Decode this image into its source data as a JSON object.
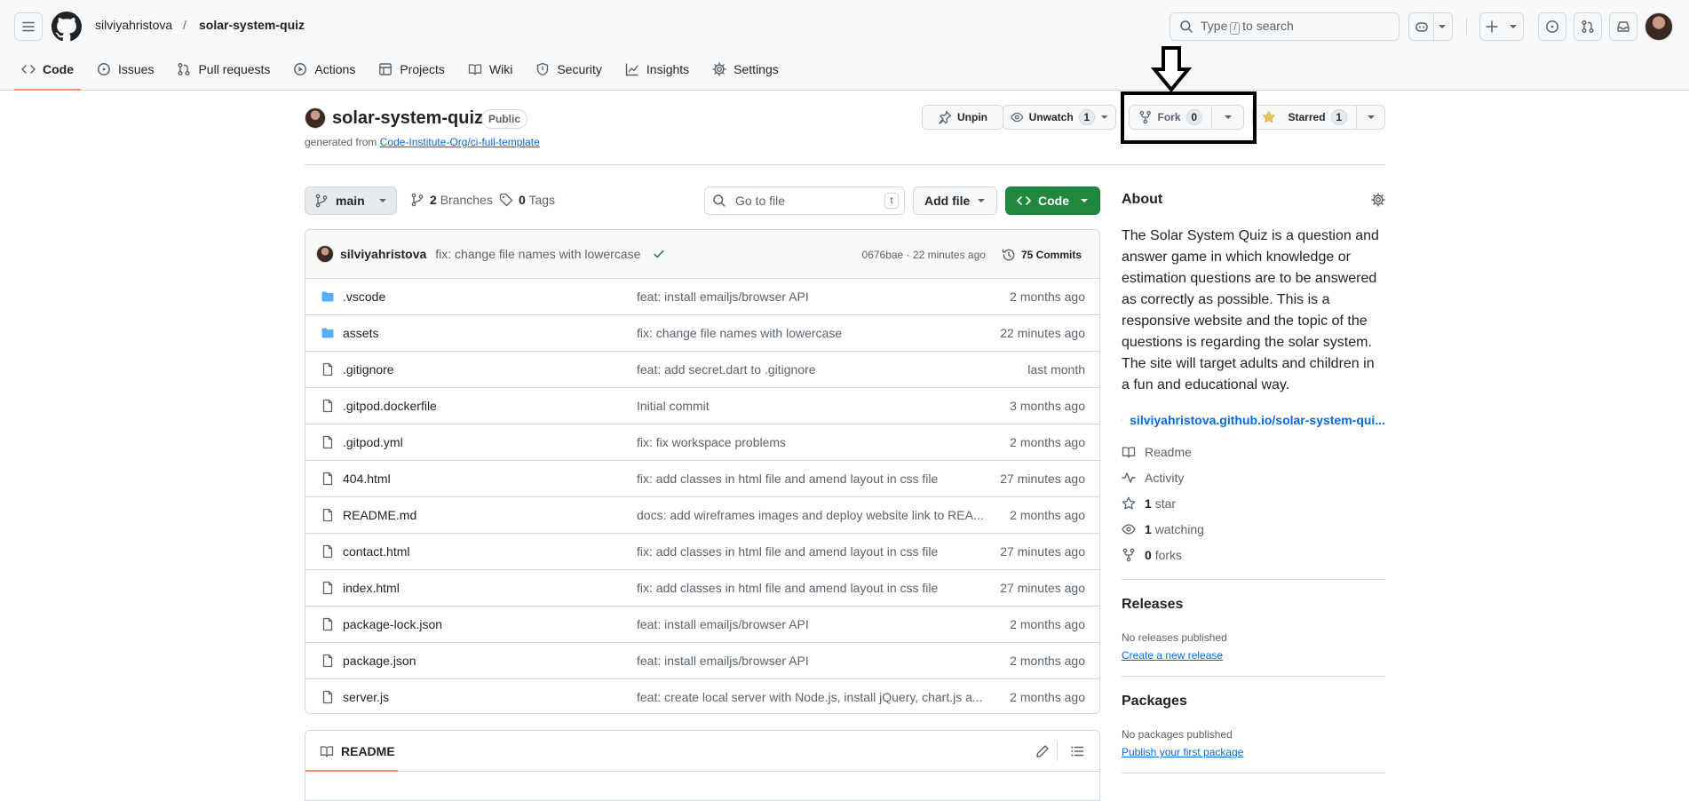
{
  "header": {
    "owner": "silviyahristova",
    "separator": "/",
    "repo": "solar-system-quiz",
    "search": {
      "prefix": "Type",
      "key": "/",
      "suffix": "to search"
    }
  },
  "tabs": [
    {
      "label": "Code",
      "icon": "code-icon",
      "selected": true
    },
    {
      "label": "Issues",
      "icon": "issue-opened-icon"
    },
    {
      "label": "Pull requests",
      "icon": "git-pull-request-icon"
    },
    {
      "label": "Actions",
      "icon": "play-icon"
    },
    {
      "label": "Projects",
      "icon": "table-icon"
    },
    {
      "label": "Wiki",
      "icon": "book-icon"
    },
    {
      "label": "Security",
      "icon": "shield-icon"
    },
    {
      "label": "Insights",
      "icon": "graph-icon"
    },
    {
      "label": "Settings",
      "icon": "gear-icon"
    }
  ],
  "repo_head": {
    "name": "solar-system-quiz",
    "visibility": "Public",
    "generated_prefix": "generated from",
    "template_link": "Code-Institute-Org/ci-full-template",
    "unpin": "Unpin",
    "unwatch": "Unwatch",
    "watch_count": "1",
    "fork": "Fork",
    "fork_count": "0",
    "starred": "Starred",
    "star_count": "1"
  },
  "toolbar": {
    "branch": "main",
    "branches_count": "2",
    "branches_label": "Branches",
    "tags_count": "0",
    "tags_label": "Tags",
    "go_to_file": "Go to file",
    "go_to_file_key": "t",
    "add_file": "Add file",
    "code": "Code"
  },
  "latest_commit": {
    "author": "silviyahristova",
    "message": "fix: change file names with lowercase",
    "sha_time": "0676bae · 22 minutes ago",
    "commits_count": "75",
    "commits_label": "Commits"
  },
  "files": [
    {
      "type": "dir",
      "name": ".vscode",
      "message": "feat: install emailjs/browser API",
      "age": "2 months ago"
    },
    {
      "type": "dir",
      "name": "assets",
      "message": "fix: change file names with lowercase",
      "age": "22 minutes ago"
    },
    {
      "type": "file",
      "name": ".gitignore",
      "message": "feat: add secret.dart to .gitignore",
      "age": "last month"
    },
    {
      "type": "file",
      "name": ".gitpod.dockerfile",
      "message": "Initial commit",
      "age": "3 months ago"
    },
    {
      "type": "file",
      "name": ".gitpod.yml",
      "message": "fix: fix workspace problems",
      "age": "2 months ago"
    },
    {
      "type": "file",
      "name": "404.html",
      "message": "fix: add classes in html file and amend layout in css file",
      "age": "27 minutes ago"
    },
    {
      "type": "file",
      "name": "README.md",
      "message": "docs: add wireframes images and deploy website link to REA...",
      "age": "2 months ago"
    },
    {
      "type": "file",
      "name": "contact.html",
      "message": "fix: add classes in html file and amend layout in css file",
      "age": "27 minutes ago"
    },
    {
      "type": "file",
      "name": "index.html",
      "message": "fix: add classes in html file and amend layout in css file",
      "age": "27 minutes ago"
    },
    {
      "type": "file",
      "name": "package-lock.json",
      "message": "feat: install emailjs/browser API",
      "age": "2 months ago"
    },
    {
      "type": "file",
      "name": "package.json",
      "message": "feat: install emailjs/browser API",
      "age": "2 months ago"
    },
    {
      "type": "file",
      "name": "server.js",
      "message": "feat: create local server with Node.js, install jQuery, chart.js a...",
      "age": "2 months ago"
    }
  ],
  "readme": {
    "tab": "README"
  },
  "about": {
    "heading": "About",
    "description": "The Solar System Quiz is a question and answer game in which knowledge or estimation questions are to be answered as correctly as possible. This is a responsive website and the topic of the questions is regarding the solar system. The site will target adults and children in a fun and educational way.",
    "website": "silviyahristova.github.io/solar-system-qui...",
    "readme": "Readme",
    "activity": "Activity",
    "stars_count": "1",
    "stars_label": "star",
    "watching_count": "1",
    "watching_label": "watching",
    "forks_count": "0",
    "forks_label": "forks"
  },
  "releases": {
    "heading": "Releases",
    "none": "No releases published",
    "create": "Create a new release"
  },
  "packages": {
    "heading": "Packages",
    "none": "No packages published",
    "publish": "Publish your first package"
  },
  "colors": {
    "accent": "#0969da",
    "primary_button": "#1f883d",
    "tab_underline": "#fd8c73",
    "folder": "#54aeff"
  }
}
